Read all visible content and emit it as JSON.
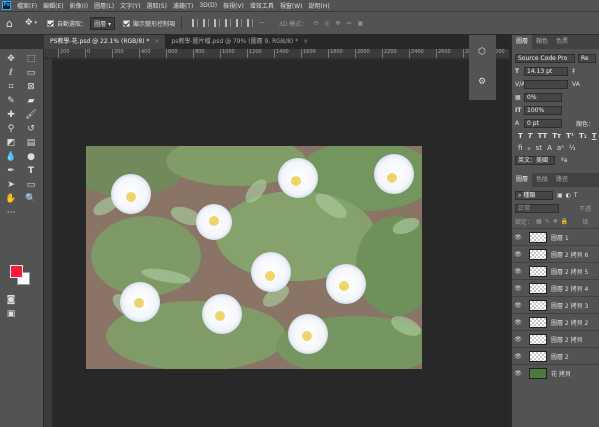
{
  "app": {
    "logo": "Ps"
  },
  "menu": [
    "檔案(F)",
    "編輯(E)",
    "影像(I)",
    "圖層(L)",
    "文字(Y)",
    "選取(S)",
    "濾鏡(T)",
    "3D(D)",
    "檢視(V)",
    "增效工具",
    "視窗(W)",
    "說明(H)"
  ],
  "options_bar": {
    "auto_select_label": "自動選取：",
    "auto_select_value": "圖層",
    "show_transform_label": "顯示變形控制項",
    "mode_3d_label": "3D 模式："
  },
  "tabs": [
    {
      "label": "PS教學-花.psd @ 22.1% (RGB/8) *",
      "close": "×"
    },
    {
      "label": "ps教學-圖片檔.psd @ 79% (圖層 9, RGB/8) *",
      "close": "×"
    }
  ],
  "ruler_ticks": [
    "200",
    "0",
    "200",
    "400",
    "600",
    "800",
    "1000",
    "1200",
    "1400",
    "1600",
    "1800",
    "2000",
    "2200",
    "2400",
    "2600",
    "2800",
    "3000"
  ],
  "panel": {
    "tabs_top": [
      "色彩",
      "色票",
      "圖層",
      "顏色",
      "色票"
    ],
    "tabs_char": [
      "圖層",
      "顏色",
      "色票"
    ],
    "font_family": "Source Code Pro",
    "font_style": "Re",
    "font_size": "14.13 pt",
    "tracking": "0%",
    "scale": "100%",
    "baseline": "0 pt",
    "color_label": "顏色：",
    "language": "英文：美國",
    "layers_tabs": [
      "圖層",
      "色版",
      "路徑"
    ],
    "kind_filter": "種類",
    "blend_mode": "正常",
    "opacity_label": "不透",
    "lock_label": "鎖定：",
    "fill_label": "填",
    "layers": [
      {
        "name": "圖層 1"
      },
      {
        "name": "圖層 2 拷貝 6"
      },
      {
        "name": "圖層 2 拷貝 5"
      },
      {
        "name": "圖層 2 拷貝 4"
      },
      {
        "name": "圖層 2 拷貝 3"
      },
      {
        "name": "圖層 2 拷貝 2"
      },
      {
        "name": "圖層 2 拷貝"
      },
      {
        "name": "圖層 2"
      },
      {
        "name": "花 拷貝"
      }
    ]
  },
  "colors": {
    "foreground": "#ff1a38",
    "background": "#ffffff",
    "accent": "#31a8ff"
  }
}
